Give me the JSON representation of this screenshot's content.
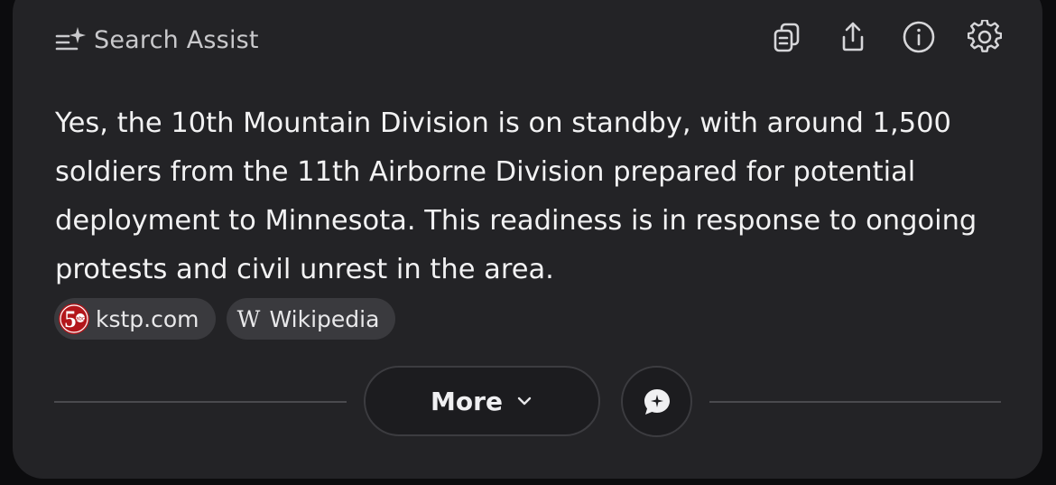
{
  "header": {
    "title": "Search Assist"
  },
  "toolbar": {
    "icons": [
      "copy-icon",
      "share-icon",
      "info-icon",
      "settings-icon"
    ]
  },
  "answer": {
    "text": "Yes, the 10th Mountain Division is on standby, with around 1,500 soldiers from the 11th Airborne Division prepared for potential deployment to Minnesota. This readiness is in response to ongoing protests and civil unrest in the area."
  },
  "sources": [
    {
      "label": "kstp.com",
      "icon": "kstp-5-icon"
    },
    {
      "label": "Wikipedia",
      "icon": "wikipedia-w-icon",
      "glyph": "W"
    }
  ],
  "actions": {
    "more_label": "More",
    "more_icon": "chevron-down-icon",
    "chat_icon": "chat-bubble-icon"
  },
  "colors": {
    "background": "#0c0c0e",
    "card": "#232326",
    "chip": "#3a3a3e",
    "text": "#f2f2f3"
  }
}
